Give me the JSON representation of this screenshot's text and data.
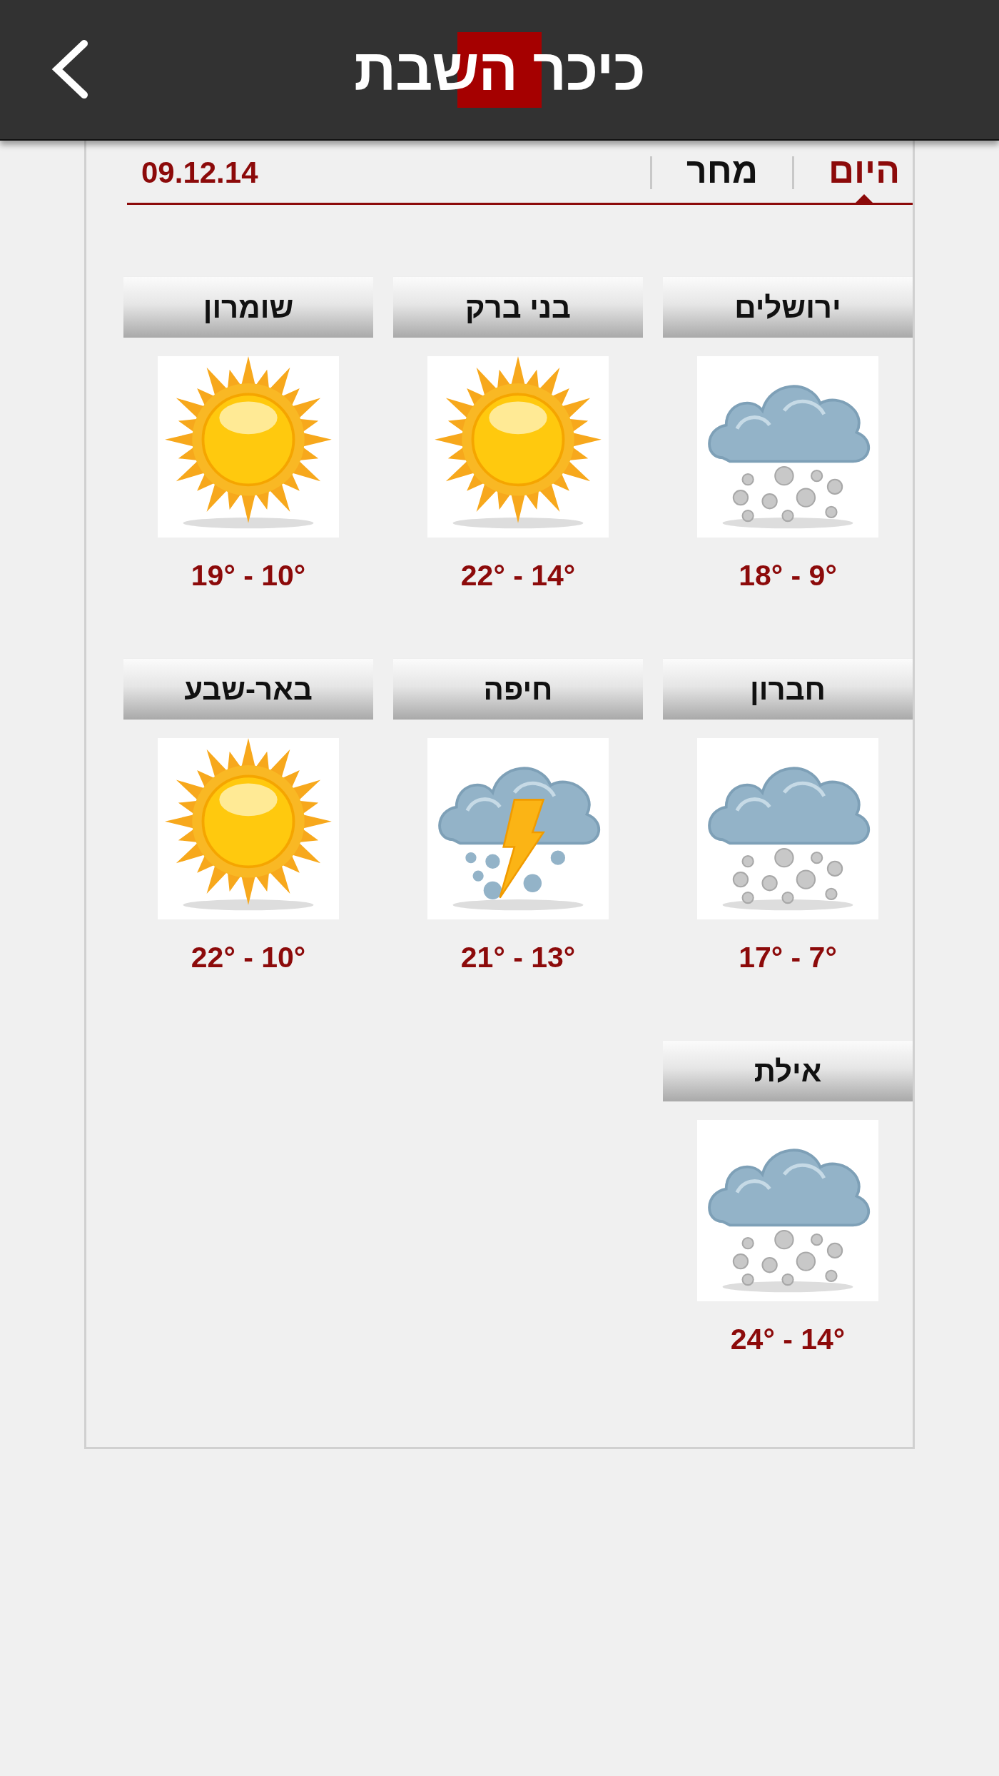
{
  "header": {
    "logo": "כיכר השבת"
  },
  "tabs": [
    {
      "label": "היום",
      "selected": true
    },
    {
      "label": "מחר",
      "selected": false
    }
  ],
  "date": "09.12.14",
  "cities": [
    {
      "name": "ירושלים",
      "kind": "snow",
      "temps": "18° - 9°"
    },
    {
      "name": "בני ברק",
      "kind": "sun",
      "temps": "22° - 14°"
    },
    {
      "name": "שומרון",
      "kind": "sun",
      "temps": "19° - 10°"
    },
    {
      "name": "חברון",
      "kind": "snow",
      "temps": "17° - 7°"
    },
    {
      "name": "חיפה",
      "kind": "storm",
      "temps": "21° - 13°"
    },
    {
      "name": "באר-שבע",
      "kind": "sun",
      "temps": "22° - 10°"
    },
    {
      "name": "אילת",
      "kind": "snow",
      "temps": "24° - 14°"
    }
  ]
}
